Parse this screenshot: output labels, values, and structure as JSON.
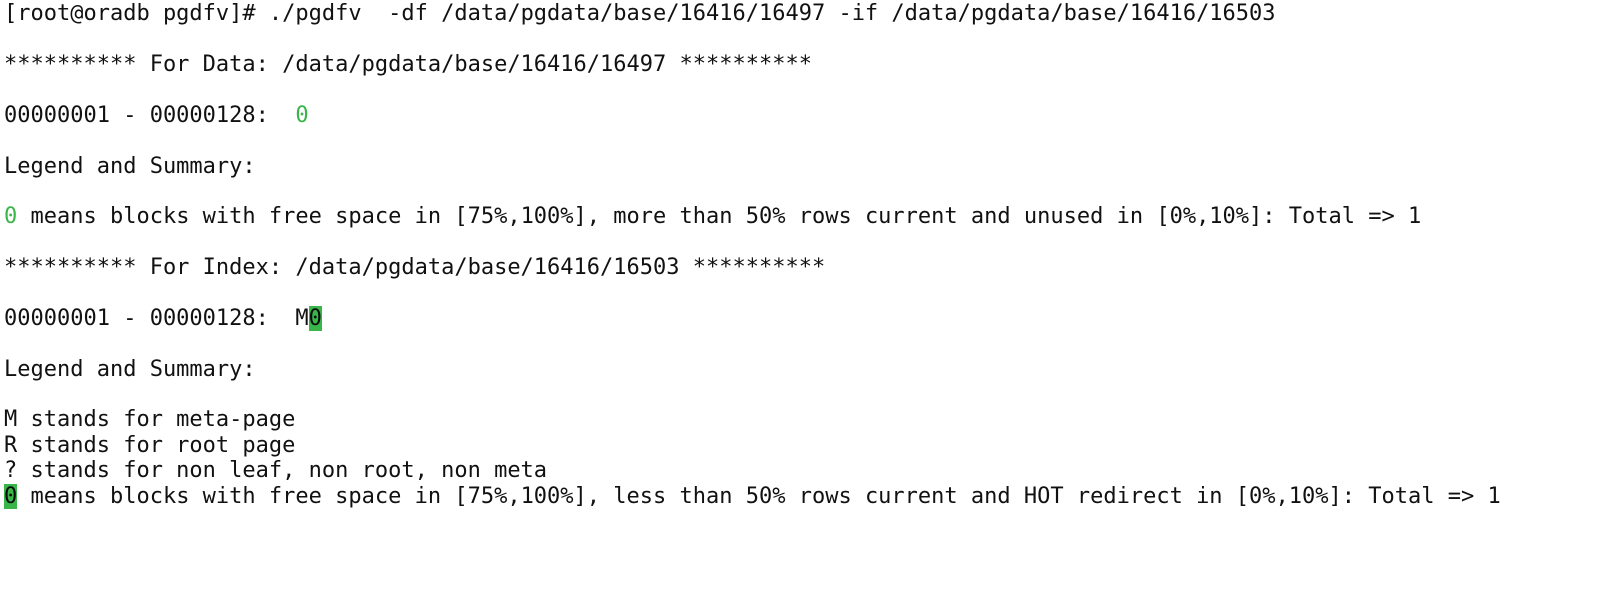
{
  "terminal": {
    "command": {
      "prompt": "[root@oradb pgdfv]# ",
      "text": "./pgdfv  -df /data/pgdata/base/16416/16497 -if /data/pgdata/base/16416/16503"
    },
    "data_section": {
      "header": "********** For Data: /data/pgdata/base/16416/16497 **********",
      "range_label": "00000001 - 00000128:  ",
      "block_map": "0",
      "legend_title": "Legend and Summary:",
      "legend_symbol": "0",
      "legend_text": " means blocks with free space in [75%,100%], more than 50% rows current and unused in [0%,10%]: Total => 1"
    },
    "index_section": {
      "header": "********** For Index: /data/pgdata/base/16416/16503 **********",
      "range_label": "00000001 - 00000128:  ",
      "block_map_prefix": "M",
      "block_map_highlight": "0",
      "legend_title": "Legend and Summary:",
      "legend_meta": "M stands for meta-page",
      "legend_root": "R stands for root page",
      "legend_nonleaf": "? stands for non leaf, non root, non meta",
      "legend_symbol": "0",
      "legend_text": " means blocks with free space in [75%,100%], less than 50% rows current and HOT redirect in [0%,10%]: Total => 1"
    },
    "colors": {
      "foreground": "#111111",
      "background": "#ffffff",
      "accent_green": "#39b54a"
    }
  }
}
